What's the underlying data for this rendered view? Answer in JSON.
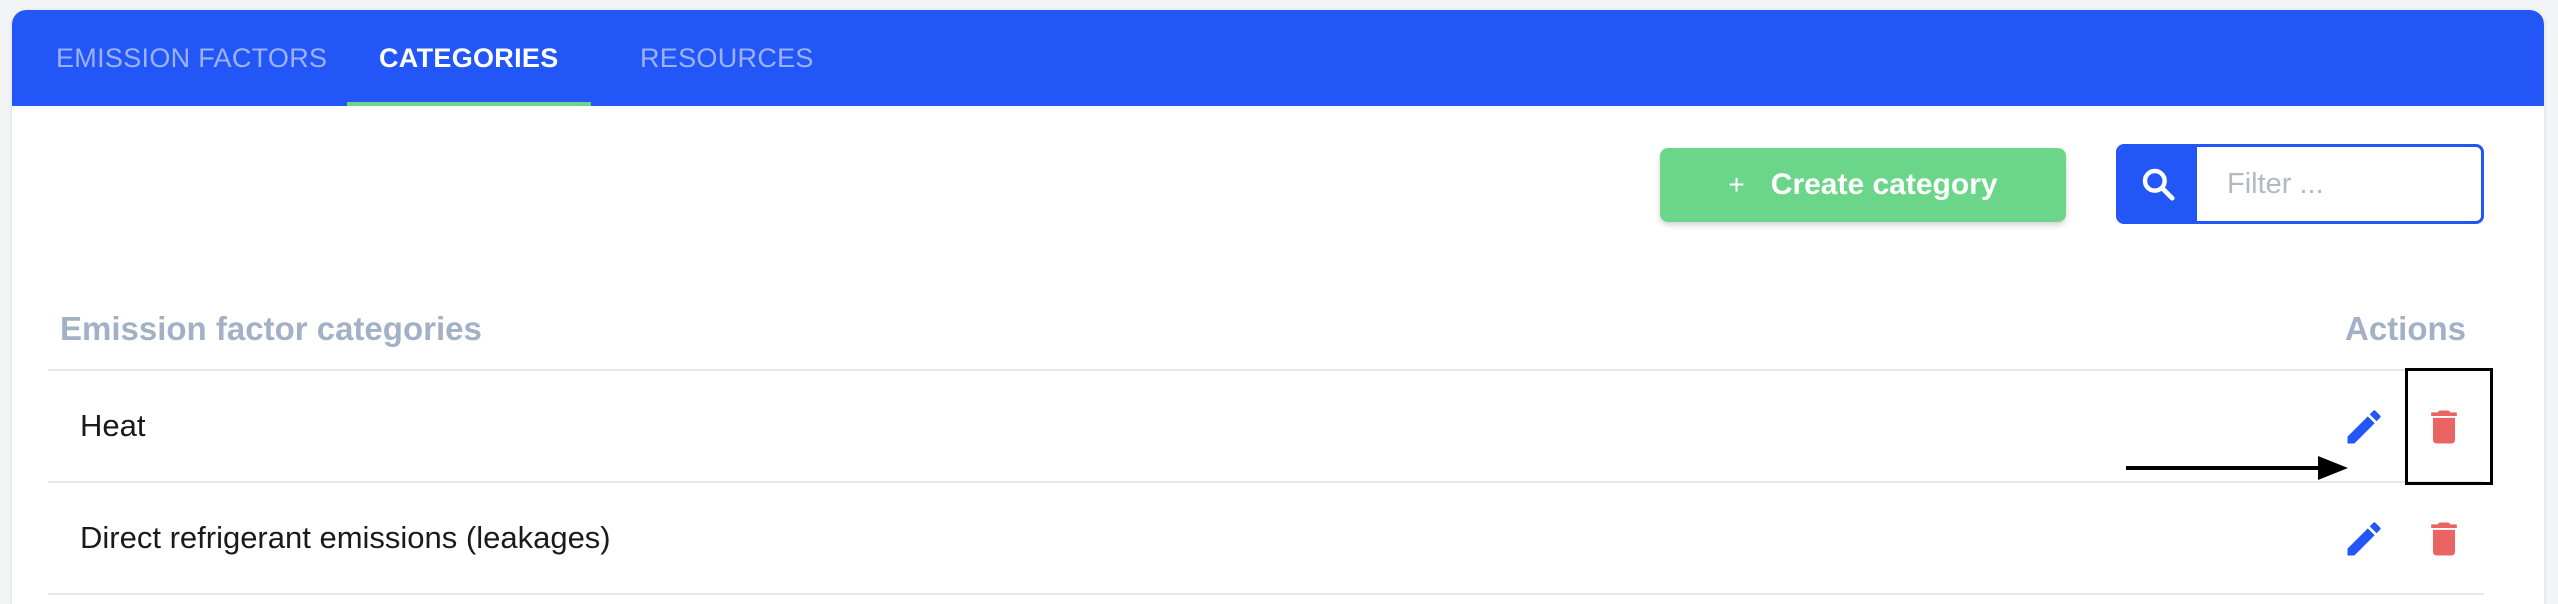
{
  "tabs": [
    {
      "label": "EMISSION FACTORS",
      "active": false
    },
    {
      "label": "CATEGORIES",
      "active": true
    },
    {
      "label": "RESOURCES",
      "active": false
    }
  ],
  "toolbar": {
    "create_plus": "+",
    "create_label": "Create category",
    "search_placeholder": "Filter ...",
    "search_value": ""
  },
  "table": {
    "column_header": "Emission factor categories",
    "actions_header": "Actions",
    "rows": [
      {
        "name": "Heat"
      },
      {
        "name": "Direct refrigerant emissions (leakages)"
      }
    ]
  },
  "icons": {
    "search": "search-icon",
    "edit": "pencil-icon",
    "delete": "trash-icon"
  },
  "colors": {
    "primary": "#2356f6",
    "success": "#6bd68a",
    "danger": "#eb6464",
    "header_text": "#a3b1c6"
  }
}
